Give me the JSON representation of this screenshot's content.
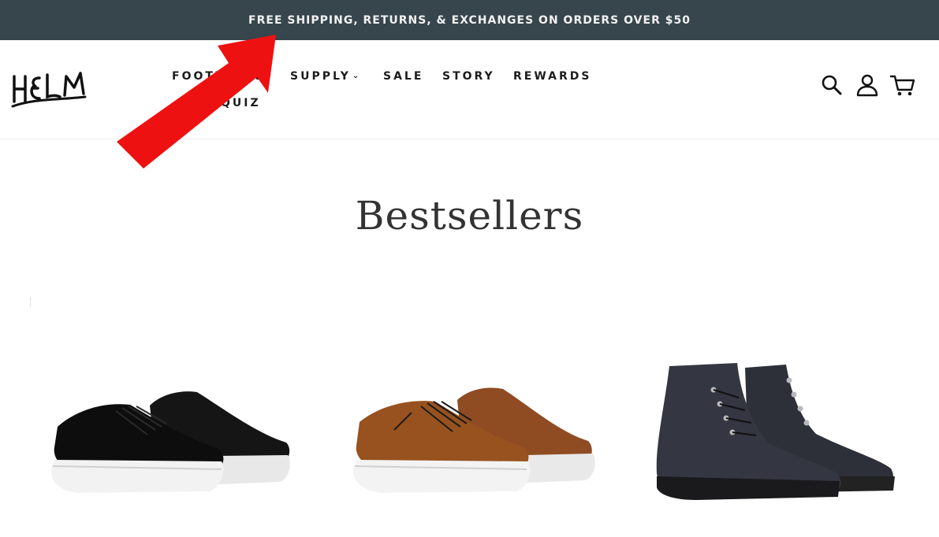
{
  "announcement": {
    "text": "FREE SHIPPING, RETURNS, & EXCHANGES ON ORDERS OVER $50",
    "background": "#37454c"
  },
  "header": {
    "logo_text": "HELM",
    "nav": {
      "footwear": "FOOTWEAR",
      "supply": "SUPPLY",
      "sale": "SALE",
      "story": "STORY",
      "rewards": "REWARDS",
      "quiz": "QUIZ"
    },
    "icons": [
      "search-icon",
      "account-icon",
      "cart-icon"
    ]
  },
  "main": {
    "title": "Bestsellers",
    "products": [
      {
        "name": "black-leather-sneaker",
        "color": "#1a1a1a"
      },
      {
        "name": "brown-leather-sneaker",
        "color": "#8a4a22"
      },
      {
        "name": "black-leather-boot",
        "color": "#2b2d35"
      }
    ]
  },
  "overlay": {
    "arrow_color": "#ee1111"
  }
}
